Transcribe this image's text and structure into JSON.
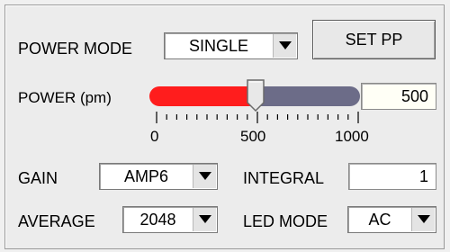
{
  "power_mode": {
    "label": "POWER MODE",
    "value": "SINGLE",
    "icon": "chevron-down-icon"
  },
  "set_pp": {
    "label": "SET PP"
  },
  "power": {
    "label": "POWER (pm)",
    "value": "500",
    "slider_value": 500,
    "slider_min": 0,
    "slider_max": 1000,
    "tick_labels": [
      "0",
      "500",
      "1000"
    ],
    "colors": {
      "filled": "#ff1d1d",
      "remaining": "#6c6c88"
    }
  },
  "gain": {
    "label": "GAIN",
    "value": "AMP6",
    "icon": "chevron-down-icon"
  },
  "integral": {
    "label": "INTEGRAL",
    "value": "1"
  },
  "average": {
    "label": "AVERAGE",
    "value": "2048",
    "icon": "chevron-down-icon"
  },
  "led_mode": {
    "label": "LED MODE",
    "value": "AC",
    "icon": "chevron-down-icon"
  }
}
